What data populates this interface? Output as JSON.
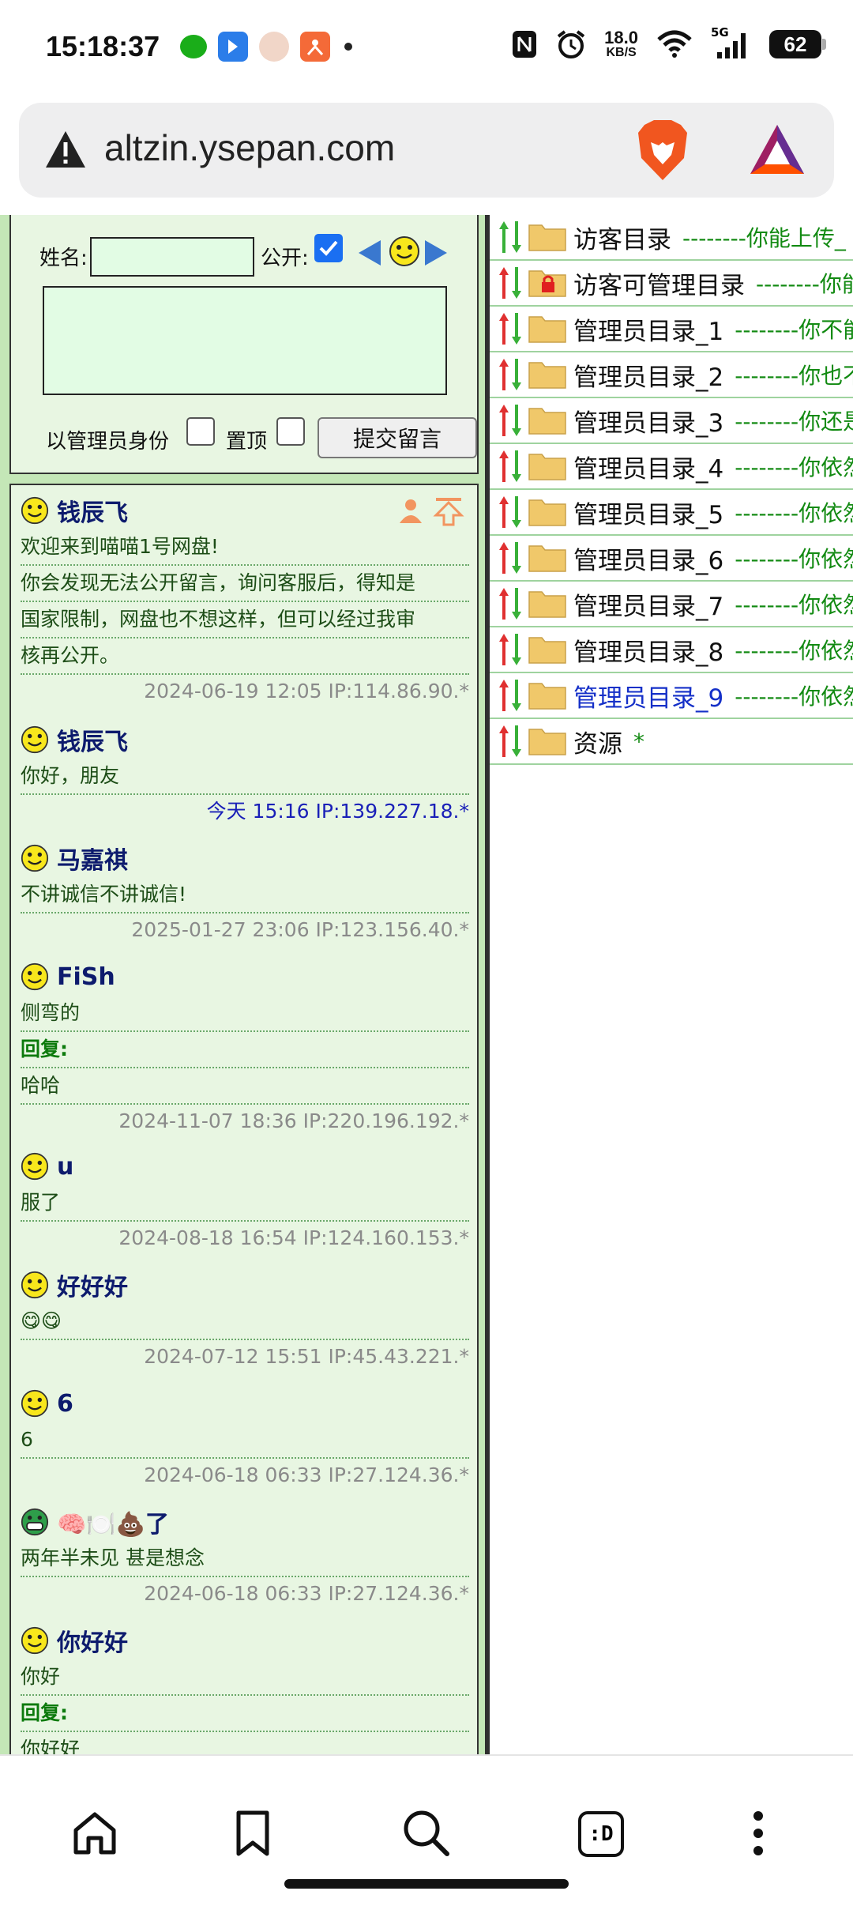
{
  "status_bar": {
    "time": "15:18:37",
    "net_speed": "18.0",
    "net_unit": "KB/S",
    "network": "5G",
    "battery": "62"
  },
  "browser": {
    "url": "altzin.ysepan.com"
  },
  "form": {
    "name_label": "姓名:",
    "public_label": "公开:",
    "admin_label": "以管理员身份",
    "pin_label": "置顶",
    "submit_label": "提交留言"
  },
  "messages": [
    {
      "author": "钱辰飞",
      "lines": [
        "欢迎来到喵喵1号网盘!",
        "你会发现无法公开留言，询问客服后，得知是",
        "国家限制，网盘也不想这样，但可以经过我审",
        "核再公开。"
      ],
      "reply": null,
      "time": "2024-06-19 12:05 IP:114.86.90.*"
    },
    {
      "author": "钱辰飞",
      "lines": [
        "你好，朋友"
      ],
      "reply": null,
      "time": "今天 15:16 IP:139.227.18.*"
    },
    {
      "author": "马嘉祺",
      "lines": [
        "不讲诚信不讲诚信!"
      ],
      "reply": null,
      "time": "2025-01-27 23:06 IP:123.156.40.*"
    },
    {
      "author": "FiSh",
      "lines": [
        "侧弯的"
      ],
      "reply_label": "回复:",
      "reply": "哈哈",
      "time": "2024-11-07 18:36 IP:220.196.192.*"
    },
    {
      "author": "u",
      "lines": [
        "服了"
      ],
      "reply": null,
      "time": "2024-08-18 16:54 IP:124.160.153.*"
    },
    {
      "author": "好好好",
      "lines": [
        "😋😋"
      ],
      "reply": null,
      "time": "2024-07-12 15:51 IP:45.43.221.*"
    },
    {
      "author": "6",
      "lines": [
        "6"
      ],
      "reply": null,
      "time": "2024-06-18 06:33 IP:27.124.36.*"
    },
    {
      "author": "🧠🍽️💩了",
      "lines": [
        "两年半未见 甚是想念"
      ],
      "reply": null,
      "time": "2024-06-18 06:33 IP:27.124.36.*"
    },
    {
      "author": "你好好",
      "lines": [
        "你好"
      ],
      "reply_label": "回复:",
      "reply": "你好好",
      "time": ""
    }
  ],
  "directories": [
    {
      "name": "访客目录",
      "desc": "--------你能上传_"
    },
    {
      "name": "访客可管理目录",
      "desc": "--------你能"
    },
    {
      "name": "管理员目录_1",
      "desc": "--------你不能"
    },
    {
      "name": "管理员目录_2",
      "desc": "--------你也不"
    },
    {
      "name": "管理员目录_3",
      "desc": "--------你还是"
    },
    {
      "name": "管理员目录_4",
      "desc": "--------你依然"
    },
    {
      "name": "管理员目录_5",
      "desc": "--------你依然"
    },
    {
      "name": "管理员目录_6",
      "desc": "--------你依然"
    },
    {
      "name": "管理员目录_7",
      "desc": "--------你依然"
    },
    {
      "name": "管理员目录_8",
      "desc": "--------你依然"
    },
    {
      "name": "管理员目录_9",
      "desc": "--------你依然"
    },
    {
      "name": "资源",
      "desc": "*"
    }
  ],
  "bottom_nav": {
    "tabs_label": ":D"
  },
  "colors": {
    "page_green": "#c4e7b7",
    "panel_green": "#e8f6e2",
    "author_navy": "#0d1b6d",
    "dir_desc_green": "#128a12",
    "link_blue": "#1530c8"
  }
}
